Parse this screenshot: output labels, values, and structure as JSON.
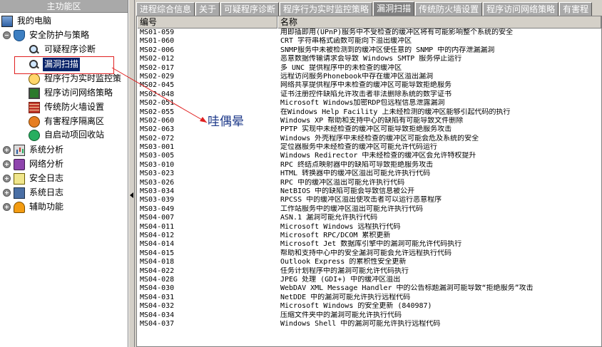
{
  "left_panel": {
    "title": "主功能区",
    "tree": [
      {
        "label": "我的电脑"
      },
      {
        "label": "安全防护与策略"
      },
      {
        "label": "可疑程序诊断"
      },
      {
        "label": "漏洞扫描"
      },
      {
        "label": "程序行为实时监控策"
      },
      {
        "label": "程序访问网络策略"
      },
      {
        "label": "传统防火墙设置"
      },
      {
        "label": "有害程序隔离区"
      },
      {
        "label": "自启动项回收站"
      },
      {
        "label": "系统分析"
      },
      {
        "label": "网络分析"
      },
      {
        "label": "安全日志"
      },
      {
        "label": "系统日志"
      },
      {
        "label": "辅助功能"
      }
    ]
  },
  "tabs": [
    "进程综合信息",
    "关于",
    "可疑程序诊断",
    "程序行为实时监控策略",
    "漏洞扫描",
    "传统防火墙设置",
    "程序访问网络策略",
    "有害程"
  ],
  "list": {
    "headers": [
      "编号",
      "名称"
    ],
    "rows": [
      [
        "MS01-059",
        "用即插即用(UPnP)服务中不受检查的缓冲区将有可能影响整个系统的安全"
      ],
      [
        "MS01-060",
        "CRT 字符串格式函数可能向下溢出缓冲区"
      ],
      [
        "MS02-006",
        "SNMP服务中未被检测到的缓冲区使任意的 SNMP 中的内存泄漏漏洞"
      ],
      [
        "MS02-012",
        "恶意数据传输请求会导致 Windows SMTP 服务停止运行"
      ],
      [
        "MS02-017",
        "多 UNC 提供程序中的未检查的缓冲区"
      ],
      [
        "MS02-029",
        "远程访问服务Phonebook中存在缓冲区溢出漏洞"
      ],
      [
        "MS02-045",
        "网络共享提供程序中未检查的缓冲区可能导致拒绝服务"
      ],
      [
        "MS02-048",
        "证书注册控件缺陷允许攻击者非法删除系统的数字证书"
      ],
      [
        "MS02-051",
        "Microsoft Windows加密RDP包远程信息泄露漏洞"
      ],
      [
        "MS02-055",
        "在Windows Help Facility 上未经检测的缓冲区能够引起代码的执行"
      ],
      [
        "MS02-060",
        "Windows XP 帮助和支持中心的缺陷有可能导致文件删除"
      ],
      [
        "MS02-063",
        "PPTP 实现中未经检查的缓冲区可能导致拒绝服务攻击"
      ],
      [
        "MS02-072",
        "Windows 外壳程序中未经检查的缓冲区可能会危及系统的安全"
      ],
      [
        "MS03-001",
        "定位器服务中未经检查的缓冲区可能允许代码运行"
      ],
      [
        "MS03-005",
        "Windows Redirector 中未经检查的缓冲区会允许特权提升"
      ],
      [
        "MS03-010",
        "RPC 终结点映射器中的缺陷可导致拒绝服务攻击"
      ],
      [
        "MS03-023",
        "HTML 转换器中的缓冲区溢出可能允许执行代码"
      ],
      [
        "MS03-026",
        "RPC 中的缓冲区溢出可能允许执行代码"
      ],
      [
        "MS03-034",
        "NetBIOS 中的缺陷可能会导致信息被公开"
      ],
      [
        "MS03-039",
        "RPCSS 中的缓冲区溢出使攻击者可以运行恶意程序"
      ],
      [
        "MS03-049",
        "工作站服务中的缓冲区溢出可能允许执行代码"
      ],
      [
        "MS04-007",
        "ASN.1 漏洞可能允许执行代码"
      ],
      [
        "MS04-011",
        "Microsoft Windows 远程执行代码"
      ],
      [
        "MS04-012",
        "Microsoft RPC/DCOM 累积更新"
      ],
      [
        "MS04-014",
        "Microsoft Jet 数据库引擎中的漏洞可能允许代码执行"
      ],
      [
        "MS04-015",
        "帮助和支持中心中的安全漏洞可能会允许远程执行代码"
      ],
      [
        "MS04-018",
        "Outlook Express 的累积性安全更新"
      ],
      [
        "MS04-022",
        "任务计划程序中的漏洞可能允许代码执行"
      ],
      [
        "MS04-028",
        "JPEG 处理 (GDI+) 中的缓冲区溢出"
      ],
      [
        "MS04-030",
        "WebDAV XML Message Handler 中的公告标题漏洞可能导致“拒绝服务”攻击"
      ],
      [
        "MS04-031",
        "NetDDE 中的漏洞可能允许执行远程代码"
      ],
      [
        "MS04-032",
        "Microsoft Windows 的安全更新 (840987)"
      ],
      [
        "MS04-034",
        "压缩文件夹中的漏洞可能允许执行代码"
      ],
      [
        "MS04-037",
        "Windows Shell 中的漏洞可能允许执行远程代码"
      ]
    ]
  },
  "annotation": {
    "text": "哇偶晕",
    "color": "#1e3a8a",
    "box_color": "#e02020"
  },
  "colors": {
    "selected": "#0a246a",
    "tab_bg": "#a9a9a9",
    "tab_active": "#808080"
  }
}
